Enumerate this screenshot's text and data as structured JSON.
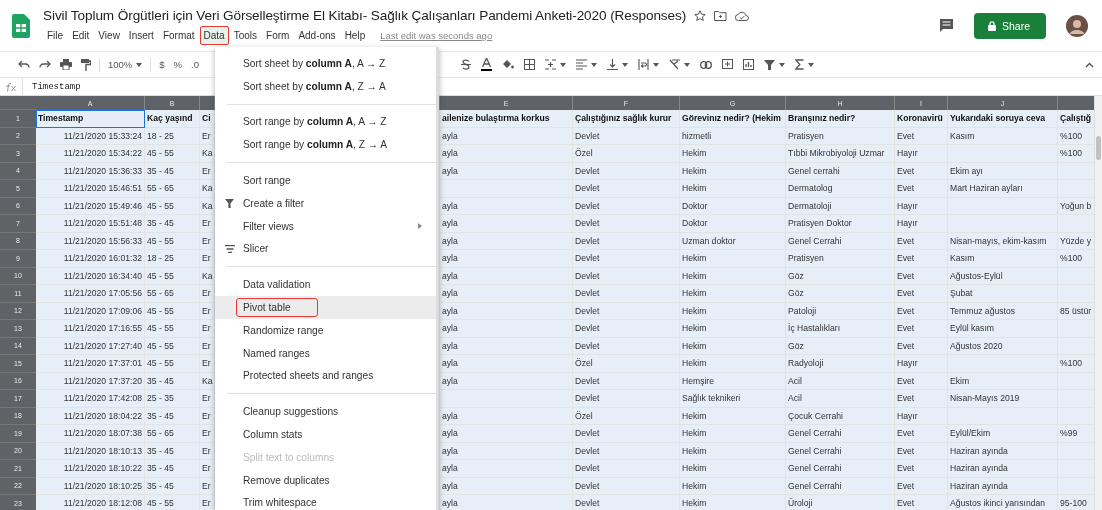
{
  "document": {
    "title": "Sivil Toplum Örgütleri için Veri Görselleştirme El Kitabı- Sağlık Çalışanları Pandemi Anketi-2020  (Responses)",
    "last_edit": "Last edit was seconds ago",
    "share_label": "Share"
  },
  "menu_bar": [
    {
      "label": "File",
      "selected": false,
      "highlighted": false
    },
    {
      "label": "Edit",
      "selected": false,
      "highlighted": false
    },
    {
      "label": "View",
      "selected": false,
      "highlighted": false
    },
    {
      "label": "Insert",
      "selected": false,
      "highlighted": false
    },
    {
      "label": "Format",
      "selected": false,
      "highlighted": false
    },
    {
      "label": "Data",
      "selected": true,
      "highlighted": true
    },
    {
      "label": "Tools",
      "selected": false,
      "highlighted": false
    },
    {
      "label": "Form",
      "selected": false,
      "highlighted": false
    },
    {
      "label": "Add-ons",
      "selected": false,
      "highlighted": false
    },
    {
      "label": "Help",
      "selected": false,
      "highlighted": false
    }
  ],
  "toolbar": {
    "zoom": "100%",
    "currency": "$",
    "percent": "%",
    "decimal": ".0"
  },
  "formula_bar": {
    "value": "Timestamp"
  },
  "sheet": {
    "columns": [
      {
        "letter": "A",
        "selected": true
      },
      {
        "letter": "B",
        "selected": true
      },
      {
        "selected": true
      },
      {
        "letter": "E",
        "selected": true
      },
      {
        "letter": "F",
        "selected": true
      },
      {
        "letter": "G",
        "selected": true
      },
      {
        "letter": "H",
        "selected": true
      },
      {
        "letter": "I",
        "selected": true
      },
      {
        "letter": "J",
        "selected": true
      },
      {
        "selected": true
      }
    ],
    "header_row": {
      "number": "1",
      "cells": [
        {
          "text": "Timestamp",
          "active": true
        },
        {
          "text": "Kaç yaşınd",
          "active": false
        },
        {
          "text": "Ci",
          "active": false
        },
        {
          "text": "ailenize bulaştırma korkus",
          "active": false
        },
        {
          "text": "Çalıştığınız sağlık kurur",
          "active": false
        },
        {
          "text": "Görevinız nedir? (Hekim",
          "active": false
        },
        {
          "text": "Branşınız nedir?",
          "active": false
        },
        {
          "text": "Koronavirü",
          "active": false
        },
        {
          "text": "Yukarıdaki soruya ceva",
          "active": false
        },
        {
          "text": "Çalıştığ",
          "active": false
        }
      ]
    },
    "rows": [
      {
        "number": "2",
        "cells": [
          "11/21/2020 15:33:24",
          "18 - 25",
          "Er",
          "ayla",
          "Devlet",
          "hizmetli",
          "Pratisyen",
          "Evet",
          "Kasım",
          "%100"
        ]
      },
      {
        "number": "3",
        "cells": [
          "11/21/2020 15:34:22",
          "45 - 55",
          "Ka",
          "ayla",
          "Özel",
          "Hekim",
          "Tıbbi Mikrobiyoloji Uzmar",
          "Hayır",
          null,
          "%100"
        ]
      },
      {
        "number": "4",
        "cells": [
          "11/21/2020 15:36:33",
          "35 - 45",
          "Er",
          "ayla",
          "Devlet",
          "Hekim",
          "Genel cerrahi",
          "Evet",
          "Ekim ayı",
          null
        ]
      },
      {
        "number": "5",
        "cells": [
          "11/21/2020 15:46:51",
          "55 - 65",
          "Ka",
          null,
          "Devlet",
          "Hekim",
          "Dermatolog",
          "Evet",
          "Mart Haziran ayları",
          null
        ]
      },
      {
        "number": "6",
        "cells": [
          "11/21/2020 15:49:46",
          "45 - 55",
          "Ka",
          "ayla",
          "Devlet",
          "Doktor",
          "Dermatoloji",
          "Hayır",
          null,
          "Yoğun b"
        ]
      },
      {
        "number": "7",
        "cells": [
          "11/21/2020 15:51:48",
          "35 - 45",
          "Er",
          "ayla",
          "Devlet",
          "Doktor",
          "Pratisyen Doktor",
          "Hayır",
          null,
          null
        ]
      },
      {
        "number": "8",
        "cells": [
          "11/21/2020 15:56:33",
          "45 - 55",
          "Er",
          "ayla",
          "Devlet",
          "Uzman doktor",
          "Genel Cerrahi",
          "Evet",
          "Nisan-mayıs, ekim-kasım",
          "Yüzde y"
        ]
      },
      {
        "number": "9",
        "cells": [
          "11/21/2020 16:01:32",
          "18 - 25",
          "Er",
          "ayla",
          "Devlet",
          "Hekim",
          "Pratisyen",
          "Evet",
          "Kasım",
          "%100"
        ]
      },
      {
        "number": "10",
        "cells": [
          "11/21/2020 16:34:40",
          "45 - 55",
          "Ka",
          "ayla",
          "Devlet",
          "Hekim",
          "Göz",
          "Evet",
          "Ağustos-Eylül",
          null
        ]
      },
      {
        "number": "11",
        "cells": [
          "11/21/2020 17:05:56",
          "55 - 65",
          "Er",
          "ayla",
          "Devlet",
          "Hekim",
          "Göz",
          "Evet",
          "Şubat",
          null
        ]
      },
      {
        "number": "12",
        "cells": [
          "11/21/2020 17:09:06",
          "45 - 55",
          "Er",
          "ayla",
          "Devlet",
          "Hekim",
          "Patoloji",
          "Evet",
          "Temmuz ağustos",
          "85 üstür"
        ]
      },
      {
        "number": "13",
        "cells": [
          "11/21/2020 17:16:55",
          "45 - 55",
          "Er",
          "ayla",
          "Devlet",
          "Hekim",
          "İç Hastalıkları",
          "Evet",
          "Eylül kasım",
          null
        ]
      },
      {
        "number": "14",
        "cells": [
          "11/21/2020 17:27:40",
          "45 - 55",
          "Er",
          "ayla",
          "Devlet",
          "Hekim",
          "Göz",
          "Evet",
          "Ağustos 2020",
          null
        ]
      },
      {
        "number": "15",
        "cells": [
          "11/21/2020 17:37:01",
          "45 - 55",
          "Er",
          "ayla",
          "Özel",
          "Hekim",
          "Radyoloji",
          "Hayır",
          null,
          "%100"
        ]
      },
      {
        "number": "16",
        "cells": [
          "11/21/2020 17:37:20",
          "35 - 45",
          "Ka",
          "ayla",
          "Devlet",
          "Hemşire",
          "Acil",
          "Evet",
          "Ekim",
          null
        ]
      },
      {
        "number": "17",
        "cells": [
          "11/21/2020 17:42:08",
          "25 - 35",
          "Er",
          null,
          "Devlet",
          "Sağlık teknikeri",
          "Acil",
          "Evet",
          "Nisan-Mayıs 2019",
          null
        ]
      },
      {
        "number": "18",
        "cells": [
          "11/21/2020 18:04:22",
          "35 - 45",
          "Er",
          "ayla",
          "Özel",
          "Hekim",
          "Çocuk Cerrahi",
          "Hayır",
          null,
          null
        ]
      },
      {
        "number": "19",
        "cells": [
          "11/21/2020 18:07:38",
          "55 - 65",
          "Er",
          "ayla",
          "Devlet",
          "Hekim",
          "Genel Cerrahi",
          "Evet",
          "Eylül/Ekim",
          "%99"
        ]
      },
      {
        "number": "20",
        "cells": [
          "11/21/2020 18:10:13",
          "35 - 45",
          "Er",
          "ayla",
          "Devlet",
          "Hekim",
          "Genel Cerrahi",
          "Evet",
          "Haziran ayında",
          null
        ]
      },
      {
        "number": "21",
        "cells": [
          "11/21/2020 18:10:22",
          "35 - 45",
          "Er",
          "ayla",
          "Devlet",
          "Hekim",
          "Genel Cerrahi",
          "Evet",
          "Haziran ayında",
          null
        ]
      },
      {
        "number": "22",
        "cells": [
          "11/21/2020 18:10:25",
          "35 - 45",
          "Er",
          "ayla",
          "Devlet",
          "Hekim",
          "Genel Cerrahi",
          "Evet",
          "Haziran ayında",
          null
        ]
      },
      {
        "number": "23",
        "cells": [
          "11/21/2020 18:12:08",
          "45 - 55",
          "Er",
          "ayla",
          "Devlet",
          "Hekim",
          "Üroloji",
          "Evet",
          "Ağustos ikinci yarısından",
          "95-100"
        ]
      }
    ]
  },
  "data_menu": [
    {
      "kind": "item",
      "label": "Sort sheet by **column A**, A → Z",
      "selected": false,
      "highlighted": false,
      "disabled": false
    },
    {
      "kind": "item",
      "label": "Sort sheet by **column A**, Z → A",
      "selected": false,
      "highlighted": false,
      "disabled": false
    },
    {
      "kind": "divider"
    },
    {
      "kind": "item",
      "label": "Sort range by **column A**, A → Z",
      "selected": false,
      "highlighted": false,
      "disabled": false
    },
    {
      "kind": "item",
      "label": "Sort range by **column A**, Z → A",
      "selected": false,
      "highlighted": false,
      "disabled": false
    },
    {
      "kind": "divider"
    },
    {
      "kind": "item",
      "label": "Sort range",
      "selected": false,
      "highlighted": false,
      "disabled": false
    },
    {
      "kind": "filter",
      "label": "Create a filter",
      "selected": false,
      "highlighted": false,
      "disabled": false
    },
    {
      "kind": "submenu",
      "label": "Filter views",
      "selected": false,
      "highlighted": false,
      "disabled": false
    },
    {
      "kind": "slicer",
      "label": "Slicer",
      "selected": false,
      "highlighted": false,
      "disabled": false
    },
    {
      "kind": "divider"
    },
    {
      "kind": "item",
      "label": "Data validation",
      "selected": false,
      "highlighted": false,
      "disabled": false
    },
    {
      "kind": "item",
      "label": "Pivot table",
      "selected": true,
      "highlighted": true,
      "disabled": false
    },
    {
      "kind": "item",
      "label": "Randomize range",
      "selected": false,
      "highlighted": false,
      "disabled": false
    },
    {
      "kind": "item",
      "label": "Named ranges",
      "selected": false,
      "highlighted": false,
      "disabled": false
    },
    {
      "kind": "item",
      "label": "Protected sheets and ranges",
      "selected": false,
      "highlighted": false,
      "disabled": false
    },
    {
      "kind": "divider"
    },
    {
      "kind": "item",
      "label": "Cleanup suggestions",
      "selected": false,
      "highlighted": false,
      "disabled": false
    },
    {
      "kind": "item",
      "label": "Column stats",
      "selected": false,
      "highlighted": false,
      "disabled": false
    },
    {
      "kind": "item",
      "label": "Split text to columns",
      "selected": false,
      "highlighted": false,
      "disabled": true
    },
    {
      "kind": "item",
      "label": "Remove duplicates",
      "selected": false,
      "highlighted": false,
      "disabled": false
    },
    {
      "kind": "item",
      "label": "Trim whitespace",
      "selected": false,
      "highlighted": false,
      "disabled": false
    }
  ]
}
